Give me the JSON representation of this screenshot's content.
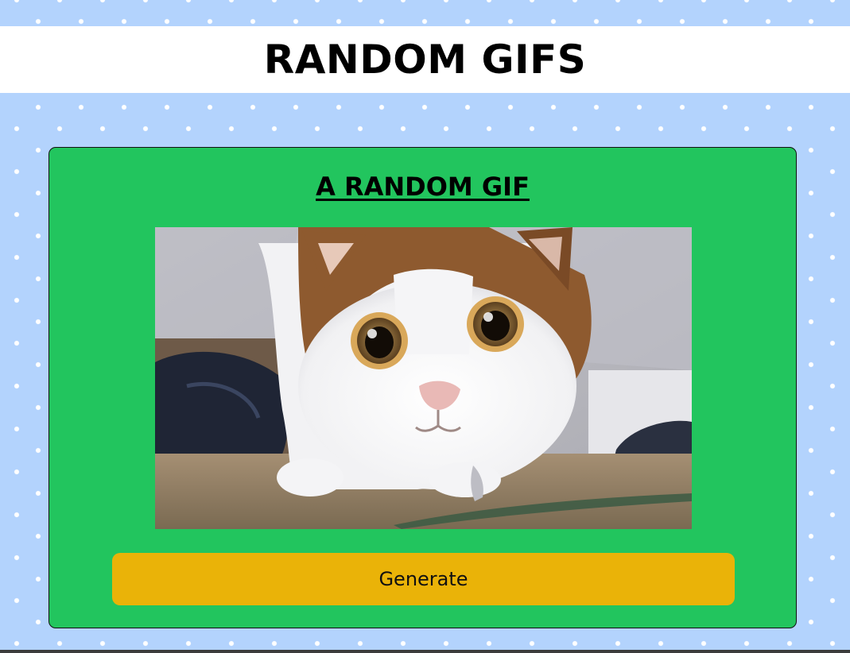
{
  "header": {
    "title": "RANDOM GIFS"
  },
  "card": {
    "title": "A RANDOM GIF",
    "image_alt": "Random GIF",
    "button_label": "Generate"
  },
  "colors": {
    "page_background": "#b3d3fd",
    "header_background": "#ffffff",
    "card_background": "#22c55e",
    "button_background": "#eab308"
  }
}
